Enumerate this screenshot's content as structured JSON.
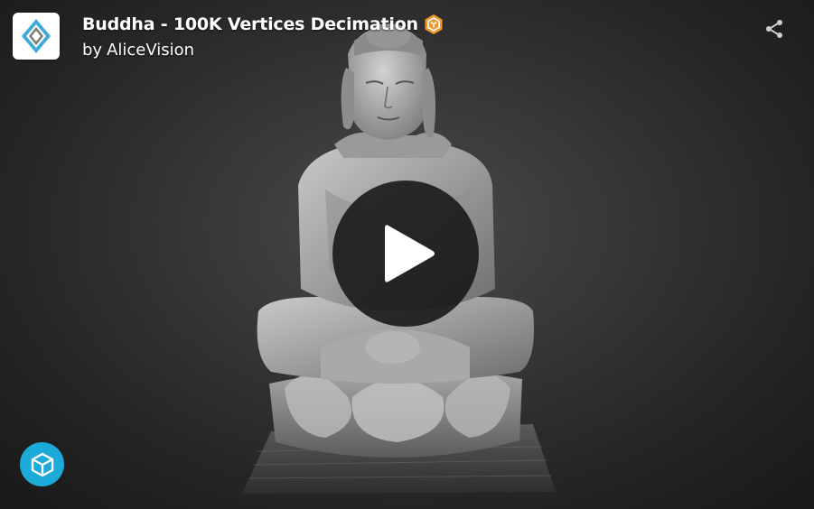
{
  "model": {
    "title": "Buddha - 100K Vertices Decimation",
    "author_prefix": "by",
    "author_name": "AliceVision"
  },
  "icons": {
    "avatar": "alicevision-logo-icon",
    "badge": "staff-pick-badge-icon",
    "share": "share-icon",
    "play": "play-icon",
    "brand": "sketchfab-logo-icon"
  },
  "colors": {
    "background_center": "#4a4a4a",
    "background_edge": "#1a1a1a",
    "badge": "#f0962a",
    "brand": "#1caad9",
    "play_overlay": "#161616"
  }
}
